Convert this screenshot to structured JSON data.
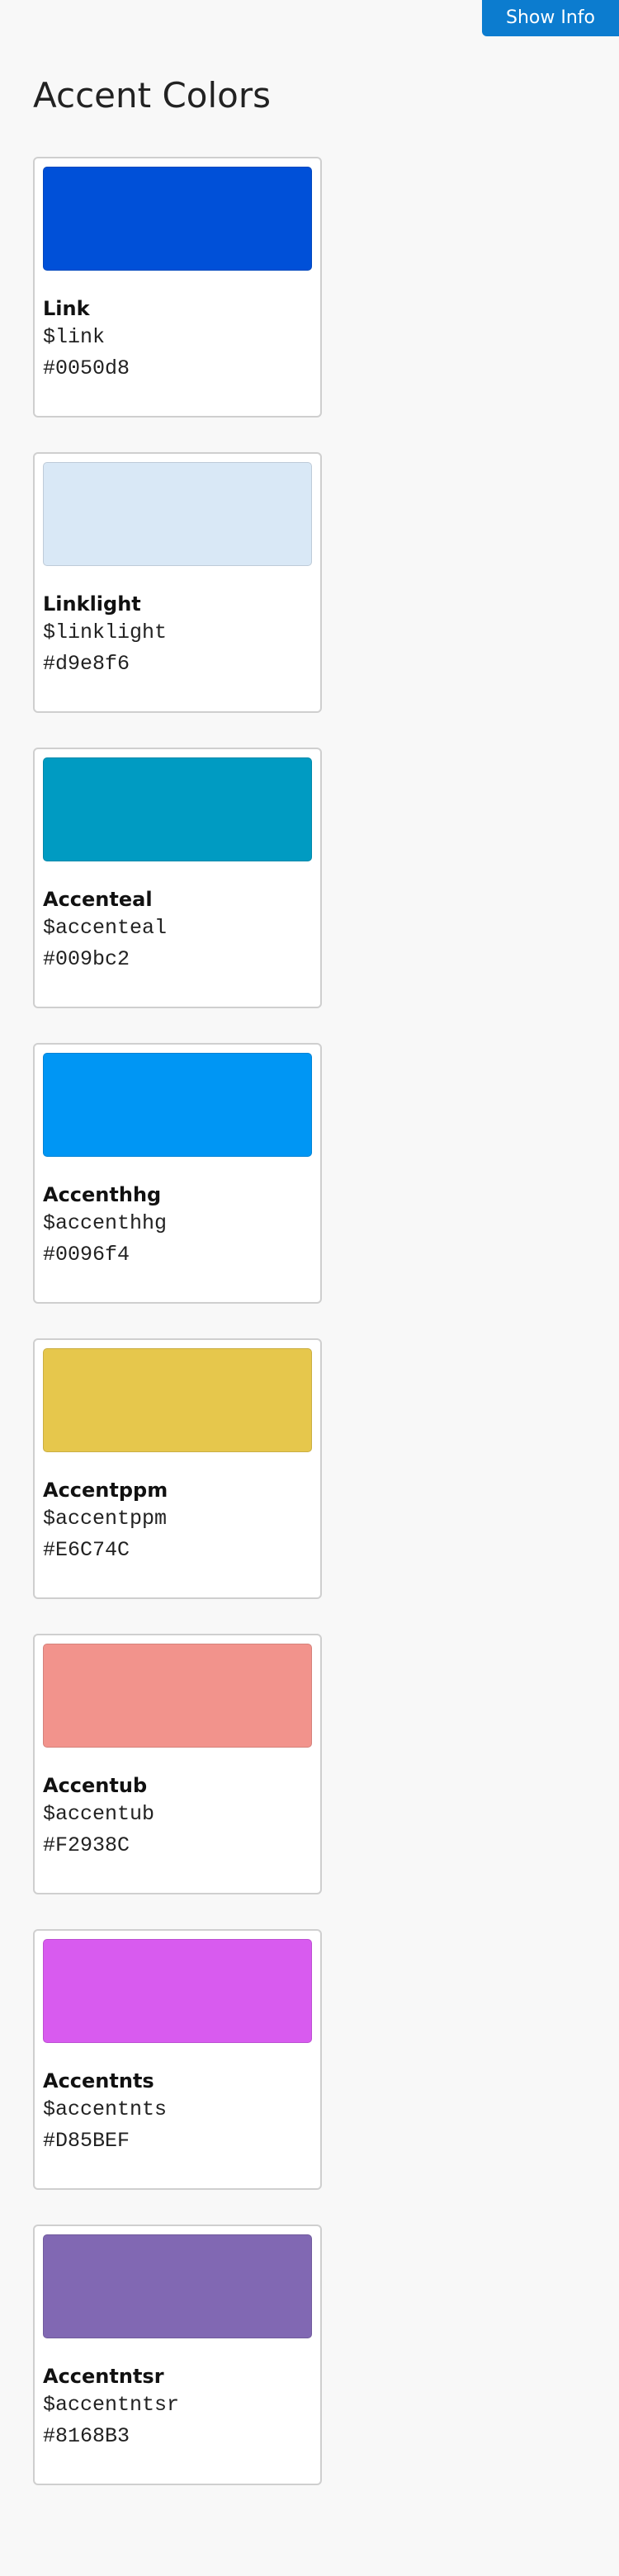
{
  "header": {
    "show_info_label": "Show Info"
  },
  "page": {
    "title": "Accent Colors"
  },
  "colors": [
    {
      "name": "Link",
      "var": "$link",
      "hex": "#0050d8",
      "swatch": "#0050d8"
    },
    {
      "name": "Linklight",
      "var": "$linklight",
      "hex": "#d9e8f6",
      "swatch": "#d9e8f6"
    },
    {
      "name": "Accenteal",
      "var": "$accenteal",
      "hex": "#009bc2",
      "swatch": "#009bc2"
    },
    {
      "name": "Accenthhg",
      "var": "$accenthhg",
      "hex": "#0096f4",
      "swatch": "#0096f4"
    },
    {
      "name": "Accentppm",
      "var": "$accentppm",
      "hex": "#E6C74C",
      "swatch": "#E6C74C"
    },
    {
      "name": "Accentub",
      "var": "$accentub",
      "hex": "#F2938C",
      "swatch": "#F2938C"
    },
    {
      "name": "Accentnts",
      "var": "$accentnts",
      "hex": "#D85BEF",
      "swatch": "#D85BEF"
    },
    {
      "name": "Accentntsr",
      "var": "$accentntsr",
      "hex": "#8168B3",
      "swatch": "#8168B3"
    }
  ]
}
